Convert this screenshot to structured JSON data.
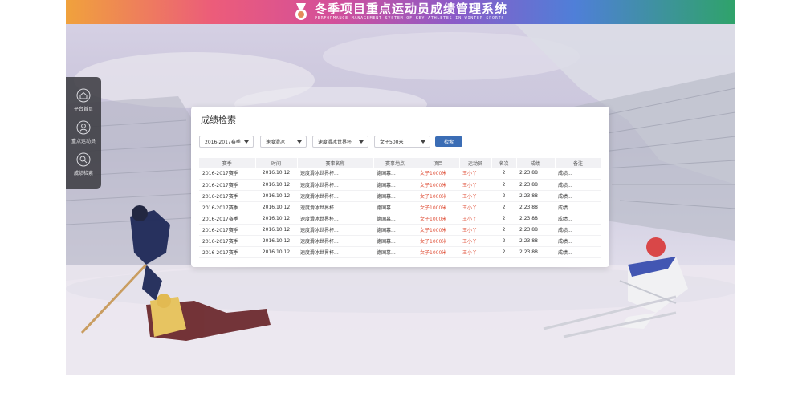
{
  "banner": {
    "title": "冬季项目重点运动员成绩管理系统",
    "subtitle": "PERFORMANCE MANAGEMENT SYSTEM OF KEY ATHLETES IN WINTER SPORTS"
  },
  "sidebar": {
    "items": [
      {
        "label": "平台首页",
        "icon": "home-icon"
      },
      {
        "label": "重点运动员",
        "icon": "athlete-icon"
      },
      {
        "label": "成绩检索",
        "icon": "search-records-icon"
      }
    ]
  },
  "panel": {
    "title": "成绩检索",
    "filters": {
      "season": "2016-2017赛季",
      "sport": "速度滑冰",
      "event": "速度滑冰世界杯",
      "item": "女子500米"
    },
    "search_label": "检索",
    "table": {
      "headers": [
        "赛季",
        "时间",
        "赛事名称",
        "赛事地点",
        "项目",
        "运动员",
        "名次",
        "成绩",
        "备注"
      ],
      "rows": [
        [
          "2016-2017赛季",
          "2016.10.12",
          "速度滑冰世界杯...",
          "德国慕...",
          "女子1000米",
          "王小丫",
          "2",
          "2.23.88",
          "成绩..."
        ],
        [
          "2016-2017赛季",
          "2016.10.12",
          "速度滑冰世界杯...",
          "德国慕...",
          "女子1000米",
          "王小丫",
          "2",
          "2.23.88",
          "成绩..."
        ],
        [
          "2016-2017赛季",
          "2016.10.12",
          "速度滑冰世界杯...",
          "德国慕...",
          "女子1000米",
          "王小丫",
          "2",
          "2.23.88",
          "成绩..."
        ],
        [
          "2016-2017赛季",
          "2016.10.12",
          "速度滑冰世界杯...",
          "德国慕...",
          "女子1000米",
          "王小丫",
          "2",
          "2.23.88",
          "成绩..."
        ],
        [
          "2016-2017赛季",
          "2016.10.12",
          "速度滑冰世界杯...",
          "德国慕...",
          "女子1000米",
          "王小丫",
          "2",
          "2.23.88",
          "成绩..."
        ],
        [
          "2016-2017赛季",
          "2016.10.12",
          "速度滑冰世界杯...",
          "德国慕...",
          "女子1000米",
          "王小丫",
          "2",
          "2.23.88",
          "成绩..."
        ],
        [
          "2016-2017赛季",
          "2016.10.12",
          "速度滑冰世界杯...",
          "德国慕...",
          "女子1000米",
          "王小丫",
          "2",
          "2.23.88",
          "成绩..."
        ],
        [
          "2016-2017赛季",
          "2016.10.12",
          "速度滑冰世界杯...",
          "德国慕...",
          "女子1000米",
          "王小丫",
          "2",
          "2.23.88",
          "成绩..."
        ]
      ]
    }
  },
  "colors": {
    "accent": "#3b6db5",
    "highlight_text": "#e0533c"
  }
}
